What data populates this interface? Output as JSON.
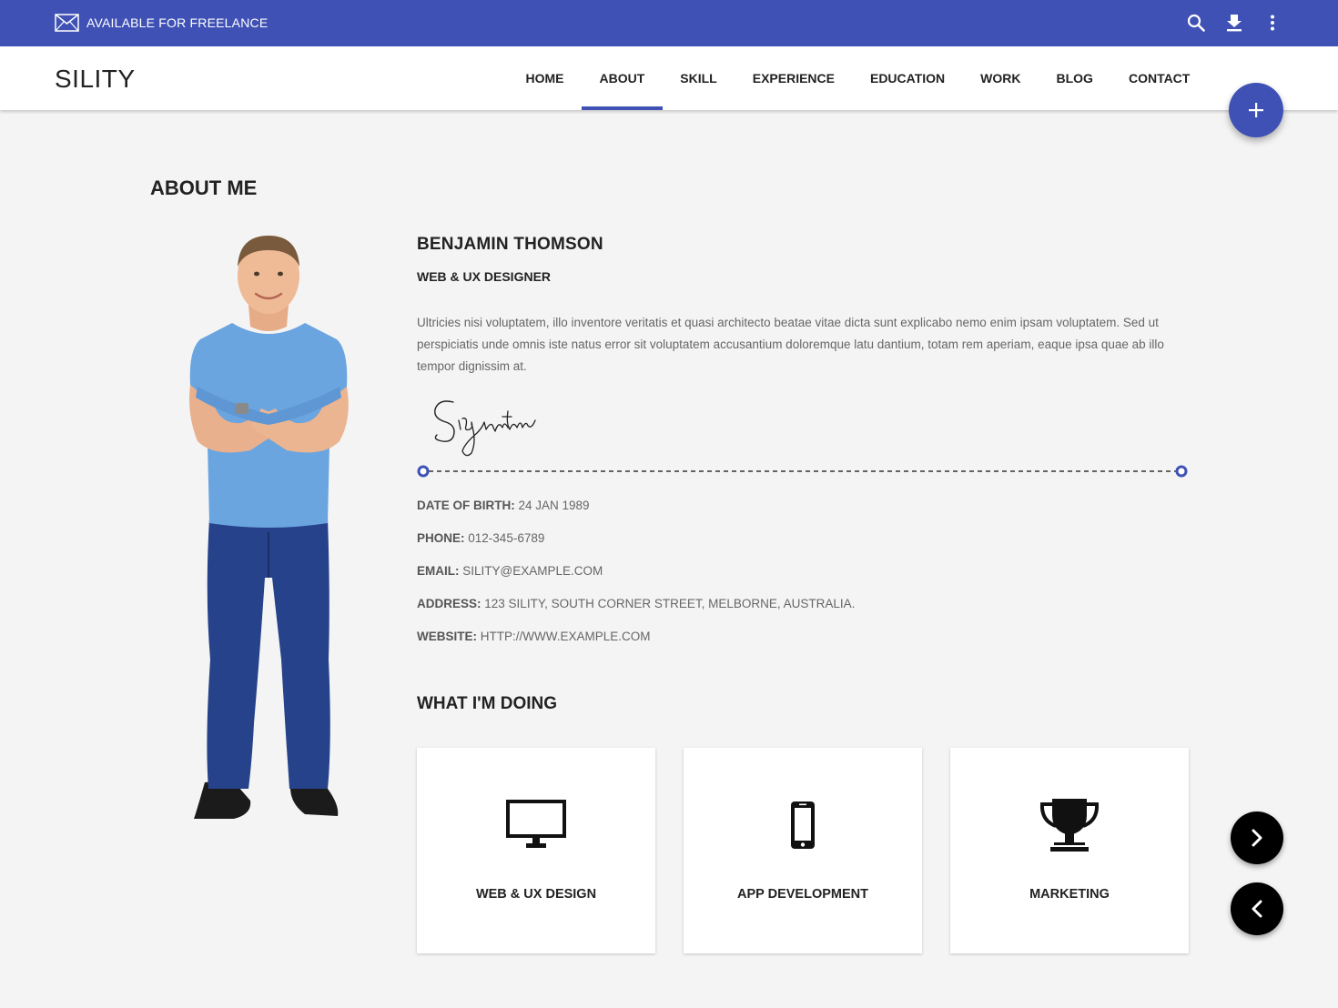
{
  "topbar": {
    "freelance_label": "AVAILABLE FOR FREELANCE",
    "background": "#3f51b5",
    "icons": [
      "mail-icon",
      "search-icon",
      "download-icon",
      "more-vert-icon"
    ]
  },
  "nav": {
    "logo": "SILITY",
    "items": [
      {
        "label": "HOME",
        "active": false
      },
      {
        "label": "ABOUT",
        "active": true
      },
      {
        "label": "SKILL",
        "active": false
      },
      {
        "label": "EXPERIENCE",
        "active": false
      },
      {
        "label": "EDUCATION",
        "active": false
      },
      {
        "label": "WORK",
        "active": false
      },
      {
        "label": "BLOG",
        "active": false
      },
      {
        "label": "CONTACT",
        "active": false
      }
    ]
  },
  "about": {
    "title": "ABOUT ME",
    "name": "BENJAMIN THOMSON",
    "role": "WEB & UX DESIGNER",
    "bio": "Ultricies nisi voluptatem, illo inventore veritatis et quasi architecto beatae vitae dicta sunt explicabo nemo enim ipsam voluptatem. Sed ut perspiciatis unde omnis iste natus error sit voluptatem accusantium doloremque latu dantium, totam rem aperiam, eaque ipsa quae ab illo tempor dignissim at.",
    "signature": "Signature",
    "info": [
      {
        "label": "DATE OF BIRTH:",
        "value": "24 JAN 1989"
      },
      {
        "label": "PHONE:",
        "value": "012-345-6789"
      },
      {
        "label": "EMAIL:",
        "value": "SILITY@EXAMPLE.COM"
      },
      {
        "label": "ADDRESS:",
        "value": "123 SILITY, SOUTH CORNER STREET, MELBORNE, AUSTRALIA."
      },
      {
        "label": "WEBSITE:",
        "value": "HTTP://WWW.EXAMPLE.COM"
      }
    ]
  },
  "doing": {
    "title": "WHAT I'M DOING",
    "cards": [
      {
        "label": "WEB & UX DESIGN",
        "icon": "monitor-icon"
      },
      {
        "label": "APP DEVELOPMENT",
        "icon": "phone-icon"
      },
      {
        "label": "MARKETING",
        "icon": "trophy-icon"
      }
    ]
  },
  "colors": {
    "accent": "#3f51b5",
    "page_bg": "#f4f4f4",
    "fab_dark": "#000000"
  }
}
